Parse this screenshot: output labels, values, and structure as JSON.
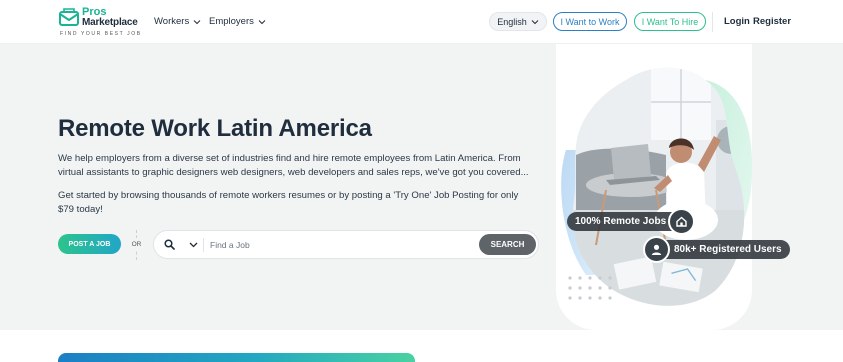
{
  "brand": {
    "line1": "Pros",
    "line2": "Marketplace",
    "tagline": "FIND YOUR BEST JOB",
    "accent": "#1ab394"
  },
  "nav": {
    "workers": "Workers",
    "employers": "Employers",
    "language": "English",
    "want_to_work": "I Want to Work",
    "want_to_hire": "I Want To Hire",
    "login": "Login",
    "register": "Register"
  },
  "hero": {
    "title": "Remote Work Latin America",
    "description": "We help employers from a diverse set of industries find and hire remote employees from Latin America. From virtual assistants to graphic designers web designers, web developers and sales reps, we've got you covered...",
    "description2": "Get started by browsing thousands of remote workers resumes or by posting a 'Try One' Job Posting for only $79 today!",
    "post_job": "POST A JOB",
    "or": "OR",
    "search_placeholder": "Find a Job",
    "search_button": "SEARCH",
    "badge_remote": "100% Remote Jobs",
    "badge_users": "80k+ Registered Users"
  },
  "icons": [
    "envelope-logo-icon",
    "chevron-down-icon",
    "search-icon",
    "home-icon",
    "user-icon"
  ]
}
